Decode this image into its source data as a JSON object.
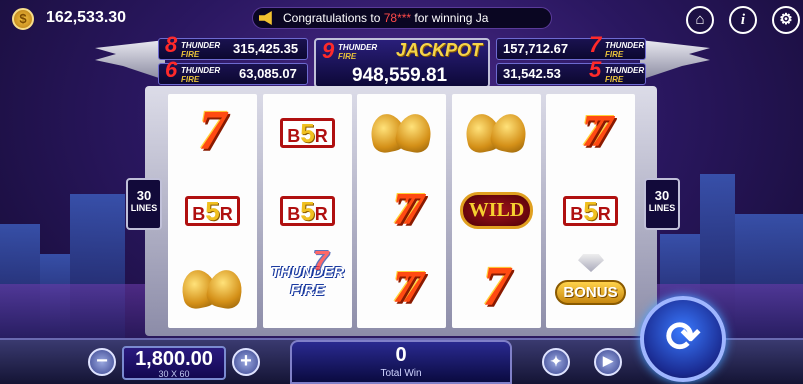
{
  "header": {
    "coin_icon": "coin-icon",
    "balance": "162,533.30",
    "ticker_prefix": "Congratulations to ",
    "ticker_name": "78***",
    "ticker_suffix": " for winning Ja",
    "home_icon": "⌂",
    "info_icon": "i",
    "settings_icon": "⚙"
  },
  "jackpots": {
    "left_top": {
      "number": "8",
      "logo_line1": "THUNDER",
      "logo_line2": "FIRE",
      "value": "315,425.35"
    },
    "left_bottom": {
      "number": "6",
      "logo_line1": "THUNDER",
      "logo_line2": "FIRE",
      "value": "63,085.07"
    },
    "center": {
      "number": "9",
      "logo_line1": "THUNDER",
      "logo_line2": "FIRE",
      "title": "JACKPOT",
      "value": "948,559.81"
    },
    "right_top": {
      "number": "7",
      "logo_line1": "THUNDER",
      "logo_line2": "FIRE",
      "value": "157,712.67"
    },
    "right_bottom": {
      "number": "5",
      "logo_line1": "THUNDER",
      "logo_line2": "FIRE",
      "value": "31,542.53"
    }
  },
  "reels": [
    [
      "single-seven",
      "b5r",
      "bells"
    ],
    [
      "b5r",
      "b5r",
      "thunder-fire"
    ],
    [
      "bells",
      "double-seven",
      "double-seven"
    ],
    [
      "bells",
      "wild",
      "single-seven"
    ],
    [
      "double-seven",
      "b5r",
      "bonus"
    ]
  ],
  "symbols": {
    "seven": "7",
    "double_seven": "77",
    "b5r_left": "B",
    "b5r_num": "5",
    "b5r_right": "R",
    "wild": "WILD",
    "bonus": "BONUS",
    "thunder_line1": "THUNDER",
    "thunder_line2": "FIRE"
  },
  "lines": {
    "count": "30",
    "label": "LINES"
  },
  "bottom": {
    "minus": "−",
    "plus": "+",
    "bet_value": "1,800.00",
    "bet_sub": "30 X 60",
    "win_value": "0",
    "win_label": "Total Win",
    "turbo_icon": "✦",
    "autoplay_icon": "▶",
    "spin_icon": "⟳"
  }
}
